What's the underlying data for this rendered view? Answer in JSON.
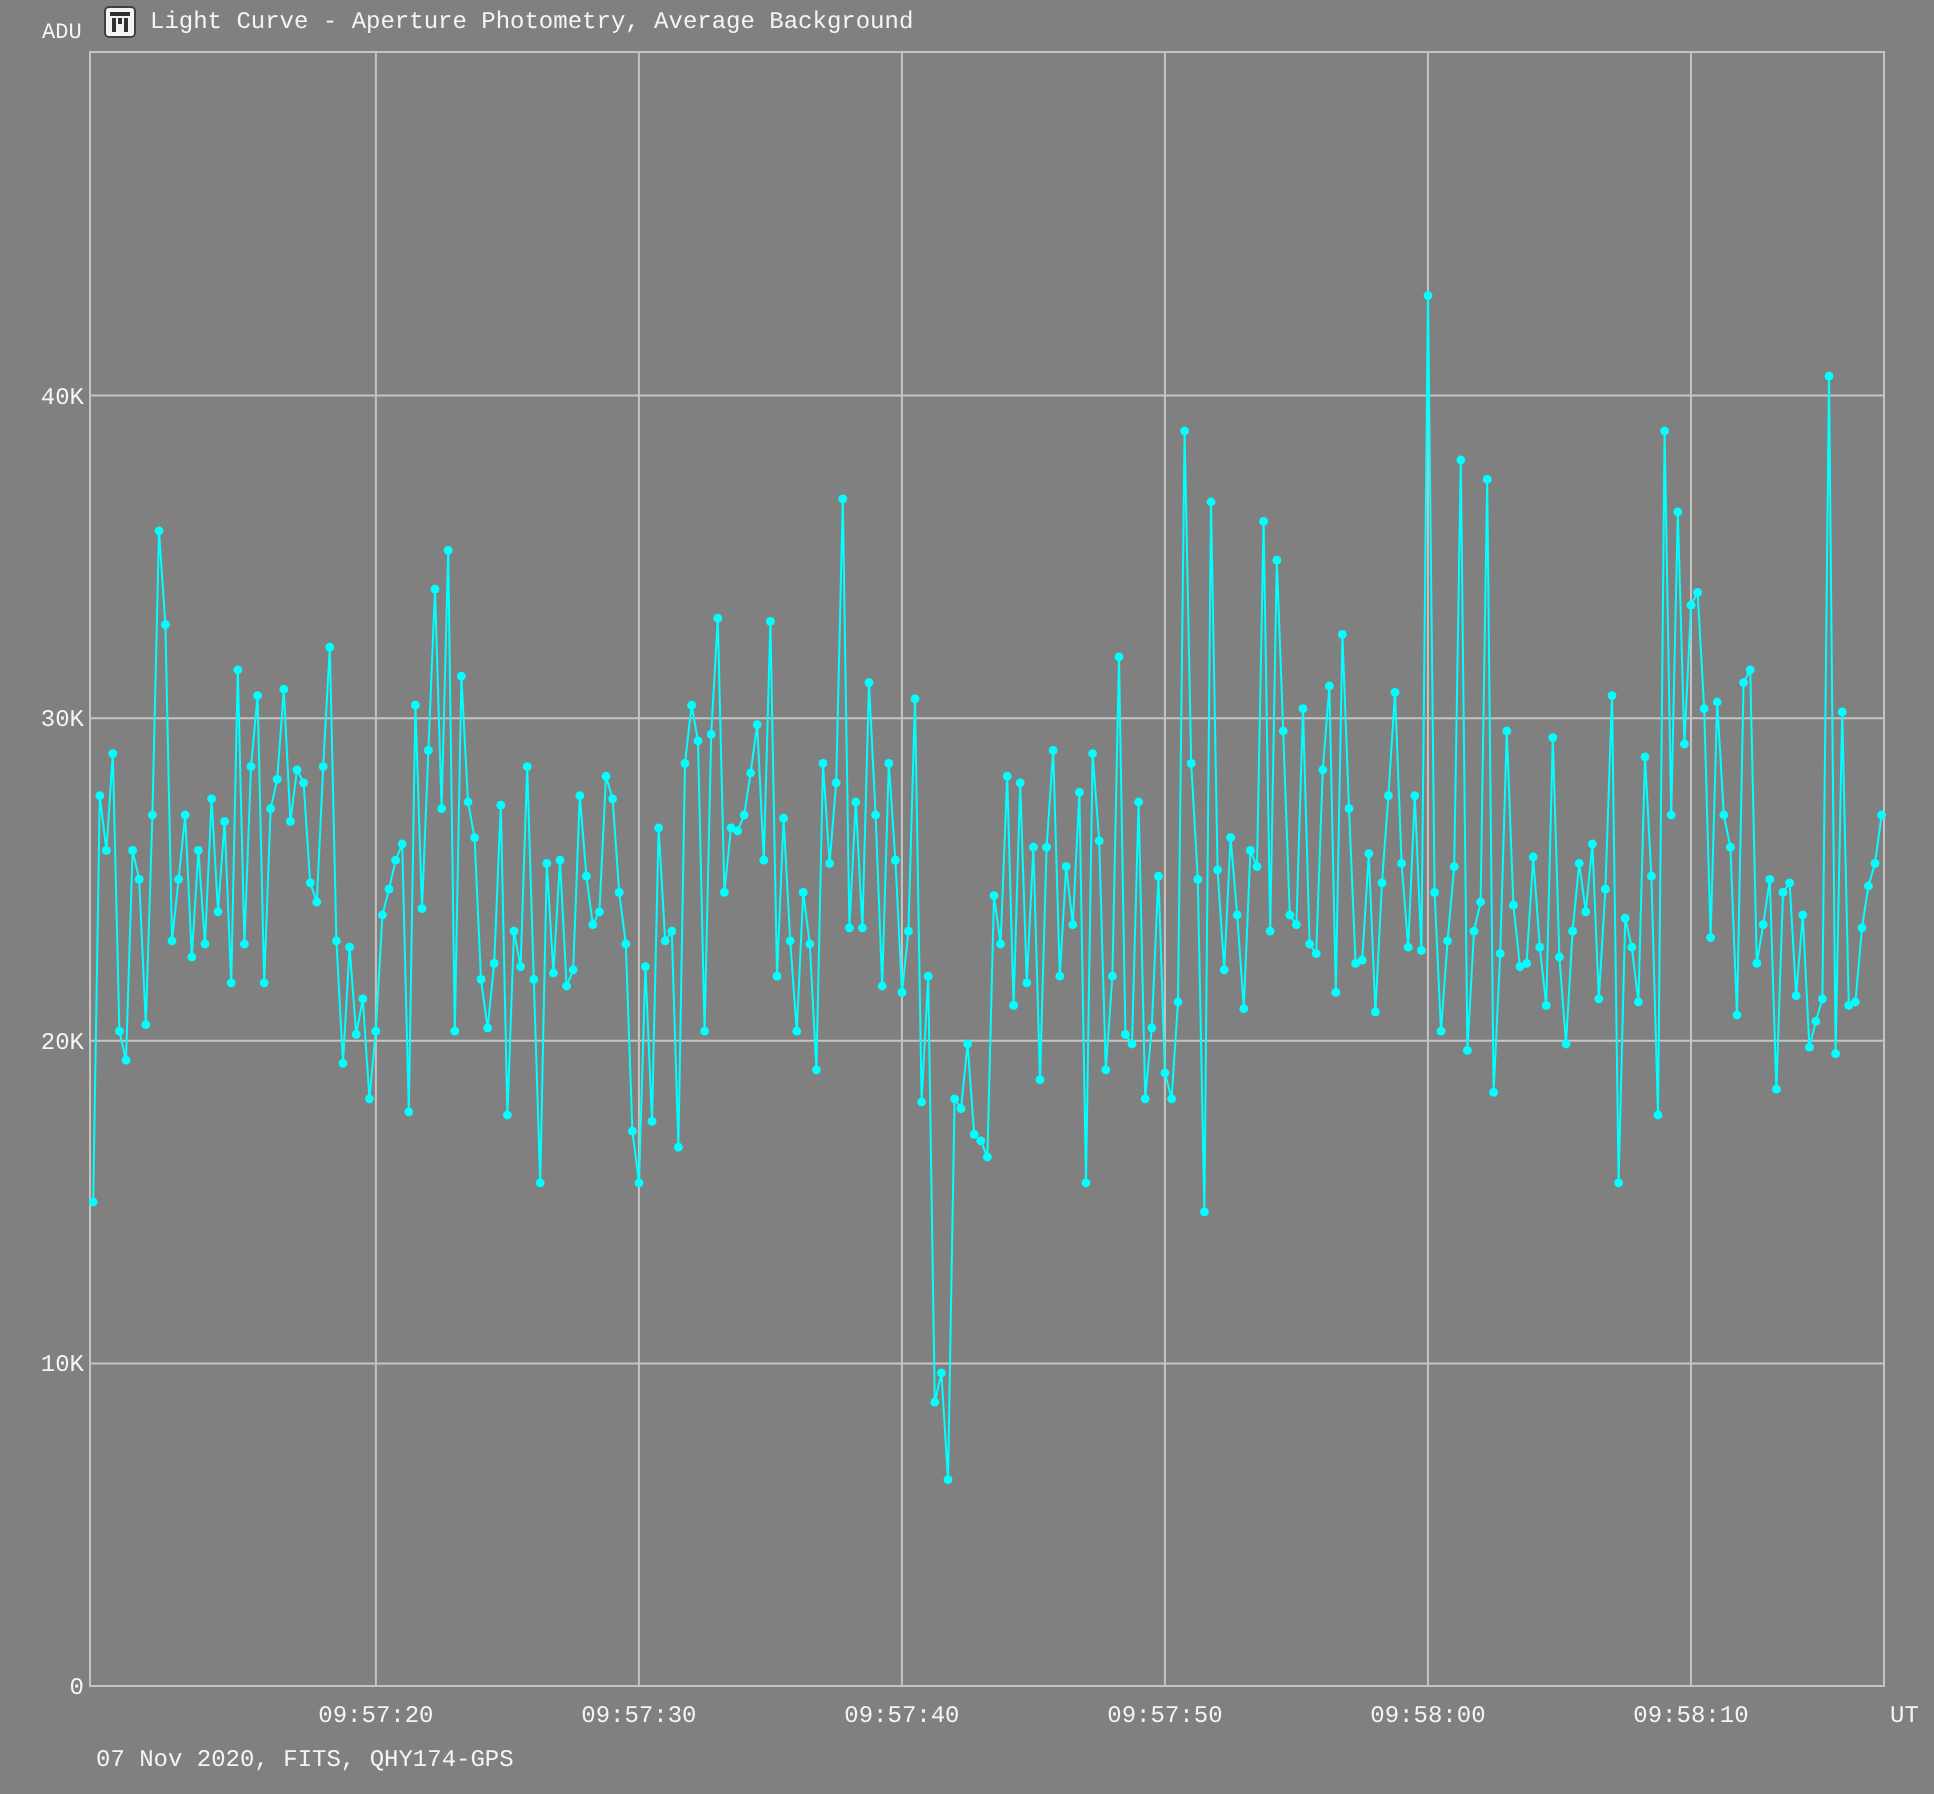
{
  "window": {
    "title": "Light Curve - Aperture Photometry, Average Background"
  },
  "chart_data": {
    "type": "line",
    "grid": true,
    "xlabel": "UT",
    "ylabel": "ADU",
    "xlim": [
      35829.13,
      35897.34
    ],
    "ylim": [
      0,
      50.65
    ],
    "xticks": [
      {
        "value": 35840,
        "label": "09:57:20"
      },
      {
        "value": 35850,
        "label": "09:57:30"
      },
      {
        "value": 35860,
        "label": "09:57:40"
      },
      {
        "value": 35870,
        "label": "09:57:50"
      },
      {
        "value": 35880,
        "label": "09:58:00"
      },
      {
        "value": 35890,
        "label": "09:58:10"
      }
    ],
    "yticks": [
      {
        "value": 0,
        "label": "0"
      },
      {
        "value": 10,
        "label": "10K"
      },
      {
        "value": 20,
        "label": "20K"
      },
      {
        "value": 30,
        "label": "30K"
      },
      {
        "value": 40,
        "label": "40K"
      }
    ],
    "x": [
      35829.25,
      35829.5,
      35829.75,
      35830,
      35830.25,
      35830.5,
      35830.75,
      35831,
      35831.25,
      35831.5,
      35831.75,
      35832,
      35832.25,
      35832.5,
      35832.75,
      35833,
      35833.25,
      35833.5,
      35833.75,
      35834,
      35834.25,
      35834.5,
      35834.75,
      35835,
      35835.25,
      35835.5,
      35835.75,
      35836,
      35836.25,
      35836.5,
      35836.75,
      35837,
      35837.25,
      35837.5,
      35837.75,
      35838,
      35838.25,
      35838.5,
      35838.75,
      35839,
      35839.25,
      35839.5,
      35839.75,
      35840,
      35840.25,
      35840.5,
      35840.75,
      35841,
      35841.25,
      35841.5,
      35841.75,
      35842,
      35842.25,
      35842.5,
      35842.75,
      35843,
      35843.25,
      35843.5,
      35843.75,
      35844,
      35844.25,
      35844.5,
      35844.75,
      35845,
      35845.25,
      35845.5,
      35845.75,
      35846,
      35846.25,
      35846.5,
      35846.75,
      35847,
      35847.25,
      35847.5,
      35847.75,
      35848,
      35848.25,
      35848.5,
      35848.75,
      35849,
      35849.25,
      35849.5,
      35849.75,
      35850,
      35850.25,
      35850.5,
      35850.75,
      35851,
      35851.25,
      35851.5,
      35851.75,
      35852,
      35852.25,
      35852.5,
      35852.75,
      35853,
      35853.25,
      35853.5,
      35853.75,
      35854,
      35854.25,
      35854.5,
      35854.75,
      35855,
      35855.25,
      35855.5,
      35855.75,
      35856,
      35856.25,
      35856.5,
      35856.75,
      35857,
      35857.25,
      35857.5,
      35857.75,
      35858,
      35858.25,
      35858.5,
      35858.75,
      35859,
      35859.25,
      35859.5,
      35859.75,
      35860,
      35860.25,
      35860.5,
      35860.75,
      35861,
      35861.25,
      35861.5,
      35861.75,
      35862,
      35862.25,
      35862.5,
      35862.75,
      35863,
      35863.25,
      35863.5,
      35863.75,
      35864,
      35864.25,
      35864.5,
      35864.75,
      35865,
      35865.25,
      35865.5,
      35865.75,
      35866,
      35866.25,
      35866.5,
      35866.75,
      35867,
      35867.25,
      35867.5,
      35867.75,
      35868,
      35868.25,
      35868.5,
      35868.75,
      35869,
      35869.25,
      35869.5,
      35869.75,
      35870,
      35870.25,
      35870.5,
      35870.75,
      35871,
      35871.25,
      35871.5,
      35871.75,
      35872,
      35872.25,
      35872.5,
      35872.75,
      35873,
      35873.25,
      35873.5,
      35873.75,
      35874,
      35874.25,
      35874.5,
      35874.75,
      35875,
      35875.25,
      35875.5,
      35875.75,
      35876,
      35876.25,
      35876.5,
      35876.75,
      35877,
      35877.25,
      35877.5,
      35877.75,
      35878,
      35878.25,
      35878.5,
      35878.75,
      35879,
      35879.25,
      35879.5,
      35879.75,
      35880,
      35880.25,
      35880.5,
      35880.75,
      35881,
      35881.25,
      35881.5,
      35881.75,
      35882,
      35882.25,
      35882.5,
      35882.75,
      35883,
      35883.25,
      35883.5,
      35883.75,
      35884,
      35884.25,
      35884.5,
      35884.75,
      35885,
      35885.25,
      35885.5,
      35885.75,
      35886,
      35886.25,
      35886.5,
      35886.75,
      35887,
      35887.25,
      35887.5,
      35887.75,
      35888,
      35888.25,
      35888.5,
      35888.75,
      35889,
      35889.25,
      35889.5,
      35889.75,
      35890,
      35890.25,
      35890.5,
      35890.75,
      35891,
      35891.25,
      35891.5,
      35891.75,
      35892,
      35892.25,
      35892.5,
      35892.75,
      35893,
      35893.25,
      35893.5,
      35893.75,
      35894,
      35894.25,
      35894.5,
      35894.75,
      35895,
      35895.25,
      35895.5,
      35895.75,
      35896,
      35896.25,
      35896.5,
      35896.75,
      35897,
      35897.25
    ],
    "series": [
      {
        "marker": "circle",
        "color": "#00ffff",
        "values": [
          15.0,
          27.6,
          25.9,
          28.9,
          20.3,
          19.4,
          25.9,
          25.0,
          20.5,
          27.0,
          35.8,
          32.9,
          23.1,
          25.0,
          27.0,
          22.6,
          25.9,
          23.0,
          27.5,
          24.0,
          26.8,
          21.8,
          31.5,
          23.0,
          28.5,
          30.7,
          21.8,
          27.2,
          28.1,
          30.9,
          26.8,
          28.4,
          28.0,
          24.9,
          24.3,
          28.5,
          32.2,
          23.1,
          19.3,
          22.9,
          20.2,
          21.3,
          18.2,
          20.3,
          23.9,
          24.7,
          25.6,
          26.1,
          17.8,
          30.4,
          24.1,
          29.0,
          34.0,
          27.2,
          35.2,
          20.3,
          31.3,
          27.4,
          26.3,
          21.9,
          20.4,
          22.4,
          27.3,
          17.7,
          23.4,
          22.3,
          28.5,
          21.9,
          15.6,
          25.5,
          22.1,
          25.6,
          21.7,
          22.2,
          27.6,
          25.1,
          23.6,
          24.0,
          28.2,
          27.5,
          24.6,
          23.0,
          17.2,
          15.6,
          22.3,
          17.5,
          26.6,
          23.1,
          23.4,
          16.7,
          28.6,
          30.4,
          29.3,
          20.3,
          29.5,
          33.1,
          24.6,
          26.6,
          26.5,
          27.0,
          28.3,
          29.8,
          25.6,
          33.0,
          22.0,
          26.9,
          23.1,
          20.3,
          24.6,
          23.0,
          19.1,
          28.6,
          25.5,
          28.0,
          36.8,
          23.5,
          27.4,
          23.5,
          31.1,
          27.0,
          21.7,
          28.6,
          25.6,
          21.5,
          23.4,
          30.6,
          18.1,
          22.0,
          8.8,
          9.7,
          6.4,
          18.2,
          17.9,
          19.9,
          17.1,
          16.9,
          16.4,
          24.5,
          23.0,
          28.2,
          21.1,
          28.0,
          21.8,
          26.0,
          18.8,
          26.0,
          29.0,
          22.0,
          25.4,
          23.6,
          27.7,
          15.6,
          28.9,
          26.2,
          19.1,
          22.0,
          31.9,
          20.2,
          19.9,
          27.4,
          18.2,
          20.4,
          25.1,
          19.0,
          18.2,
          21.2,
          38.9,
          28.6,
          25.0,
          14.7,
          36.7,
          25.3,
          22.2,
          26.3,
          23.9,
          21.0,
          25.9,
          25.4,
          36.1,
          23.4,
          34.9,
          29.6,
          23.9,
          23.6,
          30.3,
          23.0,
          22.7,
          28.4,
          31.0,
          21.5,
          32.6,
          27.2,
          22.4,
          22.5,
          25.8,
          20.9,
          24.9,
          27.6,
          30.8,
          25.5,
          22.9,
          27.6,
          22.8,
          43.1,
          24.6,
          20.3,
          23.1,
          25.4,
          38.0,
          19.7,
          23.4,
          24.3,
          37.4,
          18.4,
          22.7,
          29.6,
          24.2,
          22.3,
          22.4,
          25.7,
          22.9,
          21.1,
          29.4,
          22.6,
          19.9,
          23.4,
          25.5,
          24.0,
          26.1,
          21.3,
          24.7,
          30.7,
          15.6,
          23.8,
          22.9,
          21.2,
          28.8,
          25.1,
          17.7,
          38.9,
          27.0,
          36.4,
          29.2,
          33.5,
          33.9,
          30.3,
          23.2,
          30.5,
          27.0,
          26.0,
          20.8,
          31.1,
          31.5,
          22.4,
          23.6,
          25.0,
          18.5,
          24.6,
          24.9,
          21.4,
          23.9,
          19.8,
          20.6,
          21.3,
          40.6,
          19.6,
          30.2,
          21.1,
          21.2,
          23.5,
          24.8,
          25.5,
          27.0
        ]
      }
    ]
  },
  "caption": "07 Nov 2020, FITS, QHY174-GPS"
}
